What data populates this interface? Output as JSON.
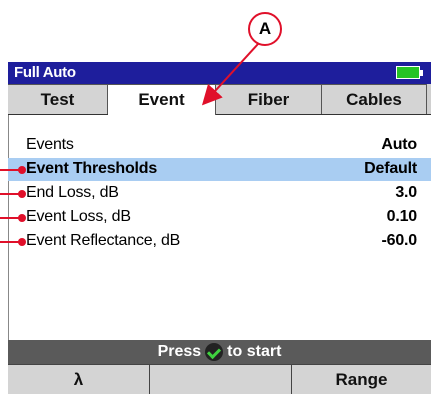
{
  "title_bar": {
    "title": "Full Auto"
  },
  "tabs": [
    {
      "label": "Test"
    },
    {
      "label": "Event",
      "active": true
    },
    {
      "label": "Fiber"
    },
    {
      "label": "Cables"
    }
  ],
  "settings": [
    {
      "label": "Events",
      "value": "Auto"
    },
    {
      "label": "Event Thresholds",
      "value": "Default",
      "selected": true
    },
    {
      "label": "End Loss, dB",
      "value": "3.0"
    },
    {
      "label": "Event Loss, dB",
      "value": "0.10"
    },
    {
      "label": "Event Reflectance, dB",
      "value": "-60.0"
    }
  ],
  "status": {
    "prefix": "Press",
    "suffix": "to start"
  },
  "softkeys": [
    {
      "label": "λ"
    },
    {
      "label": ""
    },
    {
      "label": "Range"
    }
  ],
  "callout": {
    "label": "A",
    "color": "#e0102a"
  },
  "colors": {
    "title_bar": "#1e1e9c",
    "selected_row": "#a9cdf2",
    "battery": "#25c425"
  },
  "icons": [
    "battery-icon",
    "check-icon"
  ]
}
